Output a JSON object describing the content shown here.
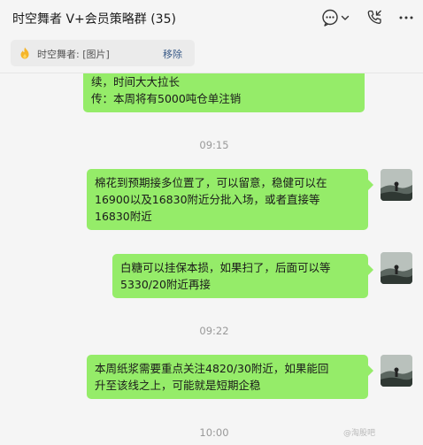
{
  "window": {
    "title": "时空舞者 V+会员策略群 (35)"
  },
  "icons": {
    "chat": "chat-bubble-icon",
    "dropdown": "chevron-down-icon",
    "call": "phone-callback-icon",
    "more": "more-icon",
    "pin": "flame-icon"
  },
  "pinned": {
    "text": "时空舞者: [图片]",
    "move_label": "移除"
  },
  "messages": [
    {
      "text": "续，时间大大拉长\n传：本周将有5000吨仓单注销"
    },
    {
      "time": "09:15",
      "text": "棉花到预期接多位置了，可以留意，稳健可以在\n16900以及16830附近分批入场，或者直接等\n16830附近"
    },
    {
      "text": "白糖可以挂保本损，如果扫了，后面可以等\n5330/20附近再接"
    },
    {
      "time": "09:22",
      "text": "本周纸浆需要重点关注4820/30附近，如果能回\n升至该线之上，可能就是短期企稳"
    },
    {
      "time": "10:00"
    }
  ],
  "watermark": "@淘股吧",
  "colors": {
    "bubble": "#95ec69",
    "accent_link": "#3a5b88",
    "background": "#f5f5f5"
  }
}
